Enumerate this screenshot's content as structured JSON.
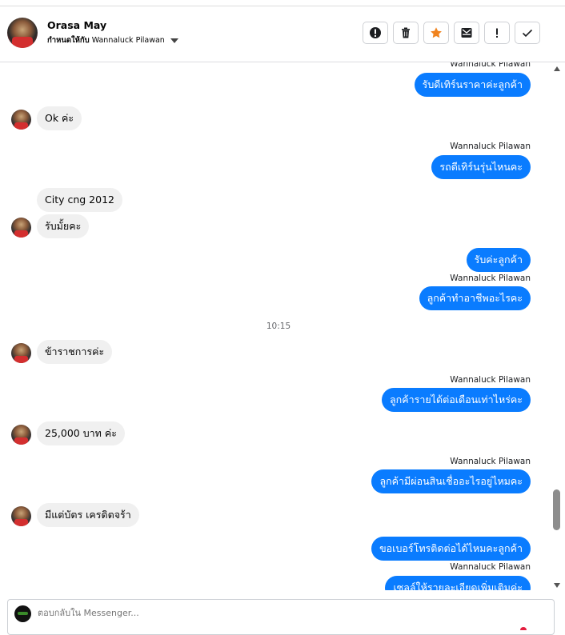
{
  "header": {
    "contact_name": "Orasa May",
    "assigned_label": "กำหนดให้กับ",
    "assigned_to": "Wannaluck Pilawan",
    "tools": [
      {
        "name": "mark-spam-button",
        "icon": "alert-circle-icon"
      },
      {
        "name": "delete-button",
        "icon": "trash-icon"
      },
      {
        "name": "star-button",
        "icon": "star-icon",
        "color": "#f0831e"
      },
      {
        "name": "mark-unread-button",
        "icon": "envelope-icon"
      },
      {
        "name": "follow-up-button",
        "icon": "exclamation-icon"
      },
      {
        "name": "mark-done-button",
        "icon": "check-icon"
      }
    ]
  },
  "chat": {
    "messages": [
      {
        "from": "agent",
        "sender": "Wannaluck Pilawan",
        "text": "รับดีเทิร์นราคาค่ะลูกค้า"
      },
      {
        "from": "customer",
        "text": "Ok ค่ะ"
      },
      {
        "from": "agent",
        "sender": "Wannaluck Pilawan",
        "text": "รถดีเทิร์นรุ่นไหนคะ"
      },
      {
        "from": "customer",
        "text": "City cng 2012"
      },
      {
        "from": "customer",
        "text": "รับมั้ยคะ"
      },
      {
        "from": "agent",
        "text": "รับค่ะลูกค้า"
      },
      {
        "from": "agent",
        "sender": "Wannaluck Pilawan",
        "text": "ลูกค้าทำอาชีพอะไรคะ"
      },
      {
        "timestamp": "10:15"
      },
      {
        "from": "customer",
        "text": "ข้าราชการค่ะ"
      },
      {
        "from": "agent",
        "sender": "Wannaluck Pilawan",
        "text": "ลูกค้ารายได้ต่อเดือนเท่าไหร่คะ"
      },
      {
        "from": "customer",
        "text": "25,000 บาท ค่ะ"
      },
      {
        "from": "agent",
        "sender": "Wannaluck Pilawan",
        "text": "ลูกค้ามีผ่อนสินเชื่ออะไรอยู่ไหมคะ"
      },
      {
        "from": "customer",
        "text": "มีแต่บัตร เครดิตจร้า"
      },
      {
        "from": "agent",
        "text": "ขอเบอร์โทรติดต่อได้ไหมคะลูกค้า"
      },
      {
        "from": "agent",
        "sender": "Wannaluck Pilawan",
        "text": "เซลล์ให้รายละเอียดเพิ่มเติมค่ะ"
      }
    ]
  },
  "composer": {
    "placeholder": "ตอบกลับใน Messenger..."
  },
  "colors": {
    "outgoing_bubble": "#0a7cff",
    "incoming_bubble": "#f0f0f0",
    "star": "#f0831e"
  }
}
